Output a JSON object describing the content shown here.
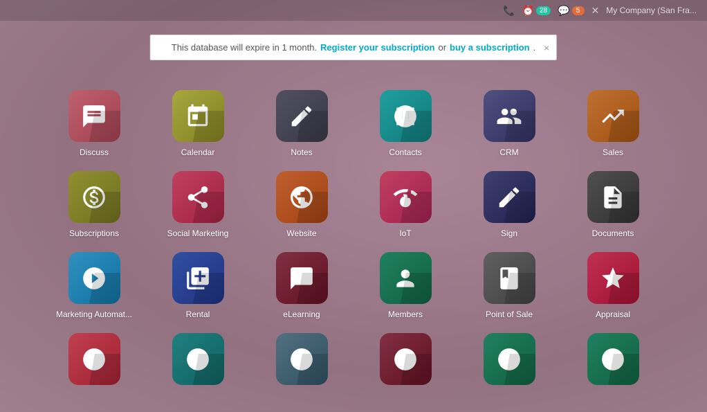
{
  "topbar": {
    "badges": [
      {
        "label": "28",
        "type": "teal",
        "icon": "clock"
      },
      {
        "label": "5",
        "type": "orange",
        "icon": "chat"
      }
    ],
    "company": "My Company (San Fra...",
    "close_icon": "✕"
  },
  "banner": {
    "text": "This database will expire in 1 month.",
    "link1_label": "Register your subscription",
    "or_text": "or",
    "link2_label": "buy a subscription",
    "period": ".",
    "close": "×"
  },
  "apps": [
    {
      "id": "discuss",
      "label": "Discuss",
      "icon_class": "icon-discuss",
      "icon": "discuss"
    },
    {
      "id": "calendar",
      "label": "Calendar",
      "icon_class": "icon-calendar",
      "icon": "calendar"
    },
    {
      "id": "notes",
      "label": "Notes",
      "icon_class": "icon-notes",
      "icon": "notes"
    },
    {
      "id": "contacts",
      "label": "Contacts",
      "icon_class": "icon-contacts",
      "icon": "contacts"
    },
    {
      "id": "crm",
      "label": "CRM",
      "icon_class": "icon-crm",
      "icon": "crm"
    },
    {
      "id": "sales",
      "label": "Sales",
      "icon_class": "icon-sales",
      "icon": "sales"
    },
    {
      "id": "subscriptions",
      "label": "Subscriptions",
      "icon_class": "icon-subscriptions",
      "icon": "subscriptions"
    },
    {
      "id": "social-marketing",
      "label": "Social Marketing",
      "icon_class": "icon-social-marketing",
      "icon": "social"
    },
    {
      "id": "website",
      "label": "Website",
      "icon_class": "icon-website",
      "icon": "website"
    },
    {
      "id": "iot",
      "label": "IoT",
      "icon_class": "icon-iot",
      "icon": "iot"
    },
    {
      "id": "sign",
      "label": "Sign",
      "icon_class": "icon-sign",
      "icon": "sign"
    },
    {
      "id": "documents",
      "label": "Documents",
      "icon_class": "icon-documents",
      "icon": "documents"
    },
    {
      "id": "marketing",
      "label": "Marketing Automat...",
      "icon_class": "icon-marketing",
      "icon": "marketing"
    },
    {
      "id": "rental",
      "label": "Rental",
      "icon_class": "icon-rental",
      "icon": "rental"
    },
    {
      "id": "elearning",
      "label": "eLearning",
      "icon_class": "icon-elearning",
      "icon": "elearning"
    },
    {
      "id": "members",
      "label": "Members",
      "icon_class": "icon-members",
      "icon": "members"
    },
    {
      "id": "pos",
      "label": "Point of Sale",
      "icon_class": "icon-pos",
      "icon": "pos"
    },
    {
      "id": "appraisal",
      "label": "Appraisal",
      "icon_class": "icon-appraisal",
      "icon": "appraisal"
    },
    {
      "id": "bottom1",
      "label": "",
      "icon_class": "icon-bottom1",
      "icon": "generic"
    },
    {
      "id": "bottom2",
      "label": "",
      "icon_class": "icon-bottom2",
      "icon": "generic"
    },
    {
      "id": "bottom3",
      "label": "",
      "icon_class": "icon-bottom3",
      "icon": "generic"
    },
    {
      "id": "bottom4",
      "label": "",
      "icon_class": "icon-bottom4",
      "icon": "generic"
    },
    {
      "id": "bottom5",
      "label": "",
      "icon_class": "icon-bottom5",
      "icon": "generic"
    },
    {
      "id": "bottom6",
      "label": "",
      "icon_class": "icon-bottom6",
      "icon": "generic"
    }
  ]
}
